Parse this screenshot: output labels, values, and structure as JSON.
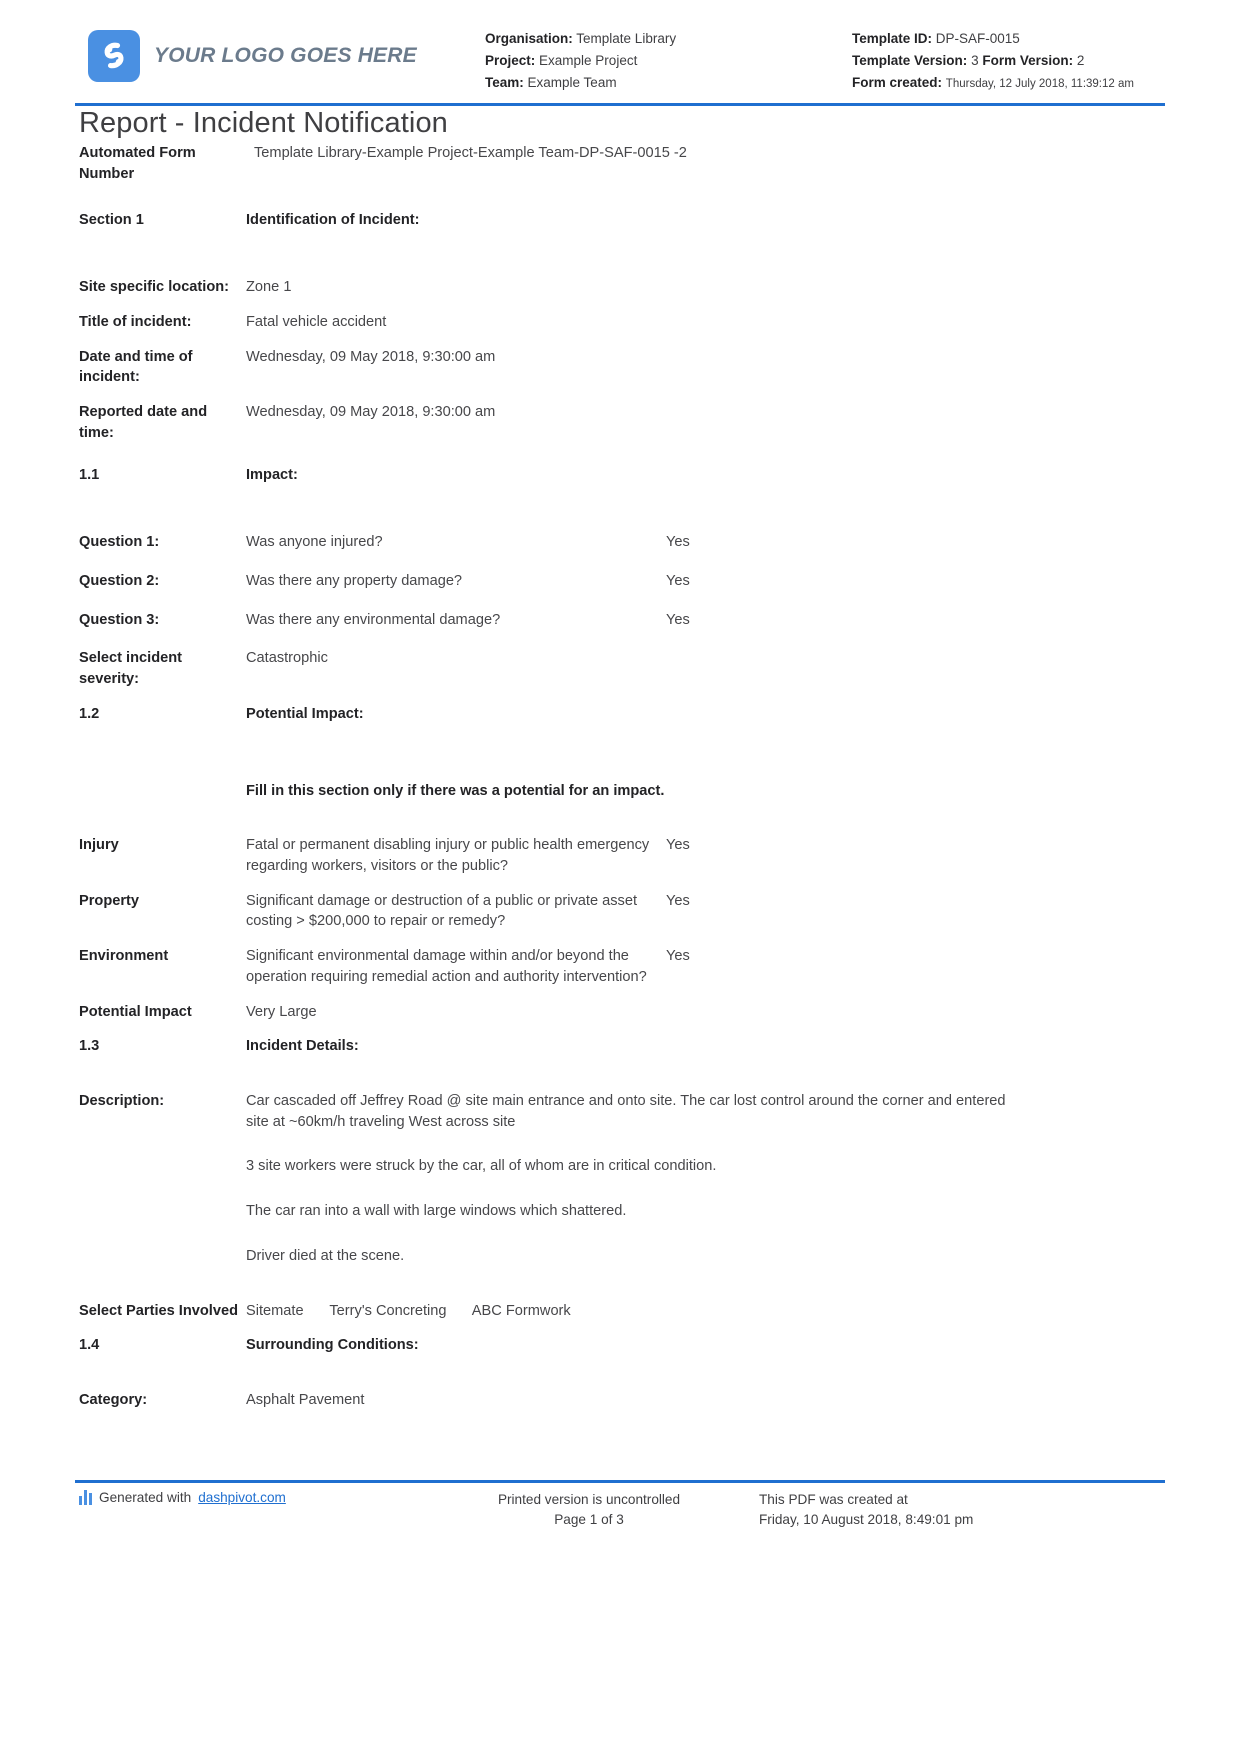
{
  "header": {
    "logo_text": "YOUR LOGO GOES HERE",
    "logo_icon": "dashpivot-s-logo-icon",
    "brand_color": "#4a90e2",
    "accent_color": "#1f6fd0",
    "organisation_label": "Organisation:",
    "organisation_value": "Template Library",
    "project_label": "Project:",
    "project_value": "Example Project",
    "team_label": "Team:",
    "team_value": "Example Team",
    "template_id_label": "Template ID:",
    "template_id_value": "DP-SAF-0015",
    "template_version_label": "Template Version:",
    "template_version_value": "3",
    "form_version_label": "Form Version:",
    "form_version_value": "2",
    "form_created_label": "Form created:",
    "form_created_value": "Thursday, 12 July 2018, 11:39:12 am"
  },
  "title": "Report - Incident Notification",
  "rows": {
    "automated_form_number_label": "Automated Form Number",
    "automated_form_number_value": "Template Library-Example Project-Example Team-DP-SAF-0015   -2",
    "section1_label": "Section 1",
    "section1_value": "Identification of Incident:",
    "site_location_label": "Site specific location:",
    "site_location_value": "Zone 1",
    "title_incident_label": "Title of incident:",
    "title_incident_value": "Fatal vehicle accident",
    "date_incident_label": "Date and time of incident:",
    "date_incident_value": "Wednesday, 09 May 2018, 9:30:00 am",
    "reported_date_label": "Reported date and time:",
    "reported_date_value": "Wednesday, 09 May 2018, 9:30:00 am",
    "s11_label": "1.1",
    "s11_value": "Impact:",
    "q1_label": "Question 1:",
    "q1_value": "Was anyone injured?",
    "q1_answer": "Yes",
    "q2_label": "Question 2:",
    "q2_value": "Was there any property damage?",
    "q2_answer": "Yes",
    "q3_label": "Question 3:",
    "q3_value": "Was there any environmental damage?",
    "q3_answer": "Yes",
    "severity_label": "Select incident severity:",
    "severity_value": "Catastrophic",
    "s12_label": "1.2",
    "s12_value": "Potential Impact:",
    "fill_note": "Fill in this section only if there was a potential for an impact.",
    "injury_label": "Injury",
    "injury_value": "Fatal or permanent disabling injury or public health emergency regarding workers, visitors or the public?",
    "injury_answer": "Yes",
    "property_label": "Property",
    "property_value": "Significant damage or destruction of a public or private asset costing > $200,000 to repair or remedy?",
    "property_answer": "Yes",
    "environment_label": "Environment",
    "environment_value": "Significant environmental damage within and/or beyond the operation requiring remedial action and authority intervention?",
    "environment_answer": "Yes",
    "potential_impact_label": "Potential Impact",
    "potential_impact_value": "Very Large",
    "s13_label": "1.3",
    "s13_value": "Incident Details:",
    "description_label": "Description:",
    "description_p1": "Car cascaded off Jeffrey Road @ site main entrance and onto site. The car lost control around the corner and entered site at ~60km/h traveling West across site",
    "description_p2": "3 site workers were struck by the car, all of whom are in critical condition.",
    "description_p3": "The car ran into a wall with large windows which shattered.",
    "description_p4": "Driver died at the scene.",
    "parties_label": "Select Parties Involved",
    "parties_values": [
      "Sitemate",
      "Terry's Concreting",
      "ABC Formwork"
    ],
    "s14_label": "1.4",
    "s14_value": "Surrounding Conditions:",
    "category_label": "Category:",
    "category_value": "Asphalt Pavement"
  },
  "footer": {
    "generated_prefix": "Generated with",
    "generated_link": "dashpivot.com",
    "printed_line1": "Printed version is uncontrolled",
    "printed_line2": "Page 1 of 3",
    "created_line1": "This PDF was created at",
    "created_line2": "Friday, 10 August 2018, 8:49:01 pm"
  }
}
